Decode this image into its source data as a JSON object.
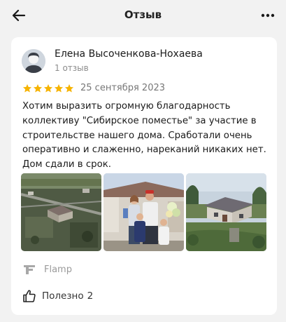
{
  "header": {
    "title": "Отзыв",
    "back_icon": "arrow-left-icon",
    "menu_icon": "more-horizontal-icon"
  },
  "review": {
    "author": "Елена Высоченкова-Нохаева",
    "author_reviews": "1 отзыв",
    "rating": 5,
    "rating_max": 5,
    "date": "25 сентября 2023",
    "text": "Хотим выразить огромную благодарность коллективу \"Сибирское поместье\" за участие в строительстве нашего дома. Сработали очень оперативно и слаженно, нареканий никаких нет. Дом сдали в срок.",
    "photos": [
      "aerial-site-photo",
      "family-photo",
      "house-photo"
    ],
    "source": "Flamp",
    "helpful_label": "Полезно",
    "helpful_count": "2"
  },
  "colors": {
    "star": "#f6b300",
    "background": "#f2f2f2",
    "card": "#ffffff",
    "muted_text": "#8c8c8c"
  }
}
